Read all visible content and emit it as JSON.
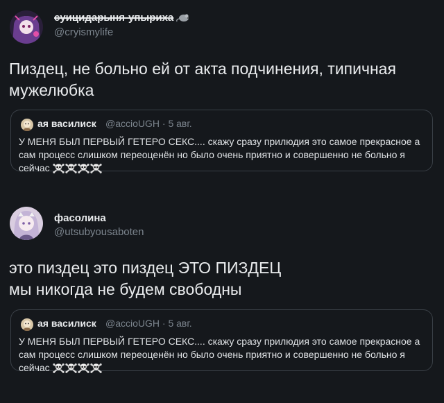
{
  "tweet1": {
    "display_name": "суицидарыня-упыриха",
    "name_icon": "mouse-icon",
    "handle": "@cryismylife",
    "text": "Пиздец, не больно ей от акта подчинения, типичная мужелюбка",
    "quote": {
      "display_name": "ая василиск",
      "handle": "@accioUGH",
      "date": "· 5 авг.",
      "text": "У МЕНЯ БЫЛ ПЕРВЫЙ ГЕТЕРО СЕКС.... скажу сразу прилюдия это самое прекрасное а сам процесс слишком переоценён но было очень приятно и совершенно не больно я сейчас",
      "emoji": [
        "skull-crossbones-icon",
        "skull-crossbones-icon",
        "skull-crossbones-icon",
        "skull-crossbones-icon"
      ]
    }
  },
  "tweet2": {
    "display_name": "фасолина",
    "handle": "@utsubyousaboten",
    "text_line1": "это пиздец это пиздец ЭТО ПИЗДЕЦ",
    "text_line2": "мы никогда не будем свободны",
    "quote": {
      "display_name": "ая василиск",
      "handle": "@accioUGH",
      "date": "· 5 авг.",
      "text": "У МЕНЯ БЫЛ ПЕРВЫЙ ГЕТЕРО СЕКС.... скажу сразу прилюдия это самое прекрасное а сам процесс слишком переоценён но было очень приятно и совершенно не больно я сейчас",
      "emoji": [
        "skull-crossbones-icon",
        "skull-crossbones-icon",
        "skull-crossbones-icon",
        "skull-crossbones-icon"
      ]
    }
  },
  "colors": {
    "background": "#15181c",
    "text": "#e9ebed",
    "secondary": "#7c858e",
    "border": "#3a4047"
  }
}
